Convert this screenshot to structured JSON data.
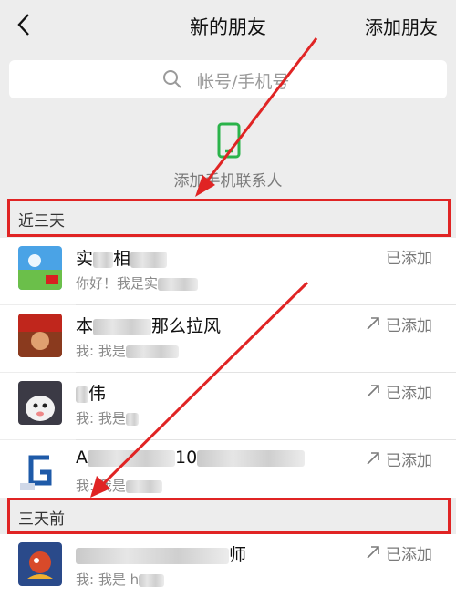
{
  "header": {
    "title": "新的朋友",
    "add_label": "添加朋友"
  },
  "search": {
    "placeholder": "帐号/手机号"
  },
  "add_phone": {
    "label": "添加手机联系人"
  },
  "sections": [
    {
      "label": "近三天"
    },
    {
      "label": "三天前"
    }
  ],
  "contacts": [
    {
      "name_visible": "实",
      "name_visible_2": "相",
      "subtitle": "你好！我是实",
      "status": "已添加"
    },
    {
      "name_visible": "本",
      "name_visible_2": "那么拉风",
      "subtitle": "我: 我是",
      "status": "已添加"
    },
    {
      "name_visible": "",
      "name_visible_2": "伟",
      "subtitle": "我: 我是",
      "status": "已添加"
    },
    {
      "name_visible": "A",
      "name_visible_2": "10",
      "subtitle": "我: 我是",
      "status": "已添加"
    },
    {
      "name_visible": "",
      "name_visible_2": "师",
      "subtitle": "我: 我是 h",
      "status": "已添加"
    }
  ],
  "colors": {
    "accent_red": "#e02424",
    "phone_green": "#2bb34a"
  }
}
